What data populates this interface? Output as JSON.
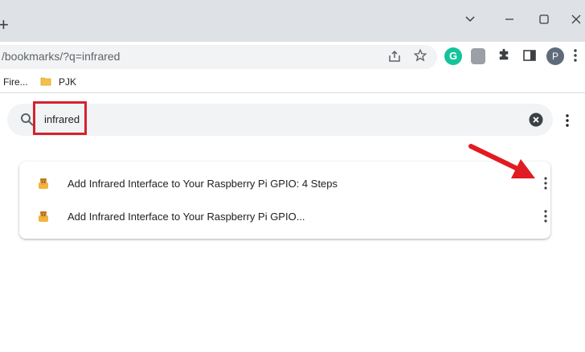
{
  "browser": {
    "new_tab_glyph": "+",
    "url_path": "/bookmarks/",
    "url_query": "?q=infrared",
    "extensions": {
      "grammarly_letter": "G"
    },
    "profile_initial": "P"
  },
  "bookmarks_bar": {
    "items": [
      {
        "label": "Fire...",
        "icon": "bookmark-favicon"
      },
      {
        "label": "PJK",
        "icon": "folder-icon"
      }
    ]
  },
  "search": {
    "value": "infrared",
    "highlight_color": "#d6212f"
  },
  "results": [
    {
      "title": "Add Infrared Interface to Your Raspberry Pi GPIO: 4 Steps",
      "icon": "instructables-favicon"
    },
    {
      "title": "Add Infrared Interface to Your Raspberry Pi GPIO...",
      "icon": "instructables-favicon"
    }
  ],
  "annotation": {
    "arrow_color": "#e11b22"
  },
  "colors": {
    "titlebar": "#dee1e6",
    "omnibox": "#f1f3f4",
    "accent_green": "#15c39a"
  }
}
